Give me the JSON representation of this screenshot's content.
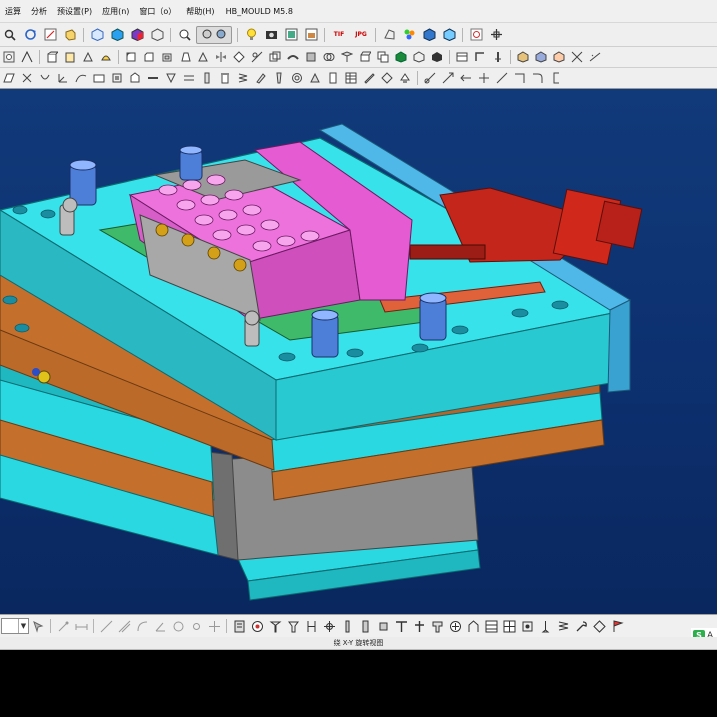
{
  "menubar": {
    "items": [
      {
        "id": "m0",
        "label": "运算"
      },
      {
        "id": "m1",
        "label": "分析"
      },
      {
        "id": "m2",
        "label": "预设置(P)"
      },
      {
        "id": "m3",
        "label": "应用(n)"
      },
      {
        "id": "m4",
        "label": "窗口（o）"
      },
      {
        "id": "m5",
        "label": "帮助(H)"
      }
    ],
    "plugin_title": "HB_MOULD M5.8"
  },
  "toolbar1": {
    "icons": [
      "search-icon",
      "regenerate-icon",
      "sketch-icon",
      "feature-icon",
      "saved-view-icon",
      "datum-icon",
      "shading-icon",
      "refit-icon",
      "zoom-icon",
      "bulb-icon",
      "camera-icon",
      "display-style-icon",
      "model-tree-icon",
      "layer-icon",
      "appearance-icon",
      "render-icon",
      "spin-center-icon",
      "orient-icon",
      "help-icon",
      "cursor-icon"
    ],
    "labels": {
      "tif": "TIF",
      "jpg": "JPG"
    }
  },
  "status": {
    "message": "绕 X-Y 旋转视图"
  },
  "badge": {
    "label": "A"
  },
  "colors": {
    "plate_cyan": "#29d8e0",
    "plate_orange": "#c46f2c",
    "slide_magenta": "#e45bd2",
    "cylinder_red": "#c4261b",
    "background_blue": "#0d3170"
  }
}
